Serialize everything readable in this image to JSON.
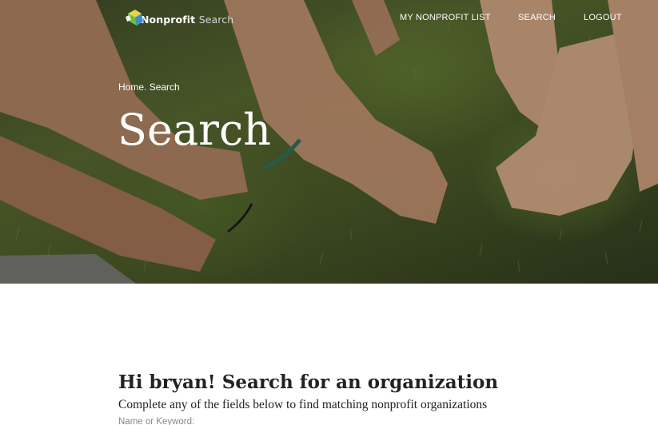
{
  "header": {
    "logo": {
      "text_main": "Nonprofit",
      "text_suffix": "Search",
      "icon": "puzzle-piece-icon"
    },
    "nav": [
      {
        "label": "MY NONPROFIT LIST"
      },
      {
        "label": "SEARCH"
      },
      {
        "label": "LOGOUT"
      }
    ]
  },
  "hero": {
    "breadcrumb": {
      "home": "Home",
      "separator": ".",
      "current": "Search"
    },
    "title": "Search"
  },
  "main": {
    "greeting": "Hi bryan! Search for an organization",
    "subtitle": "Complete any of the fields below to find matching nonprofit organizations",
    "field_label": "Name or Keyword:"
  },
  "colors": {
    "hero_overlay": "#3f4a2a",
    "text_dark": "#222222",
    "label_gray": "#888888",
    "white": "#ffffff"
  }
}
